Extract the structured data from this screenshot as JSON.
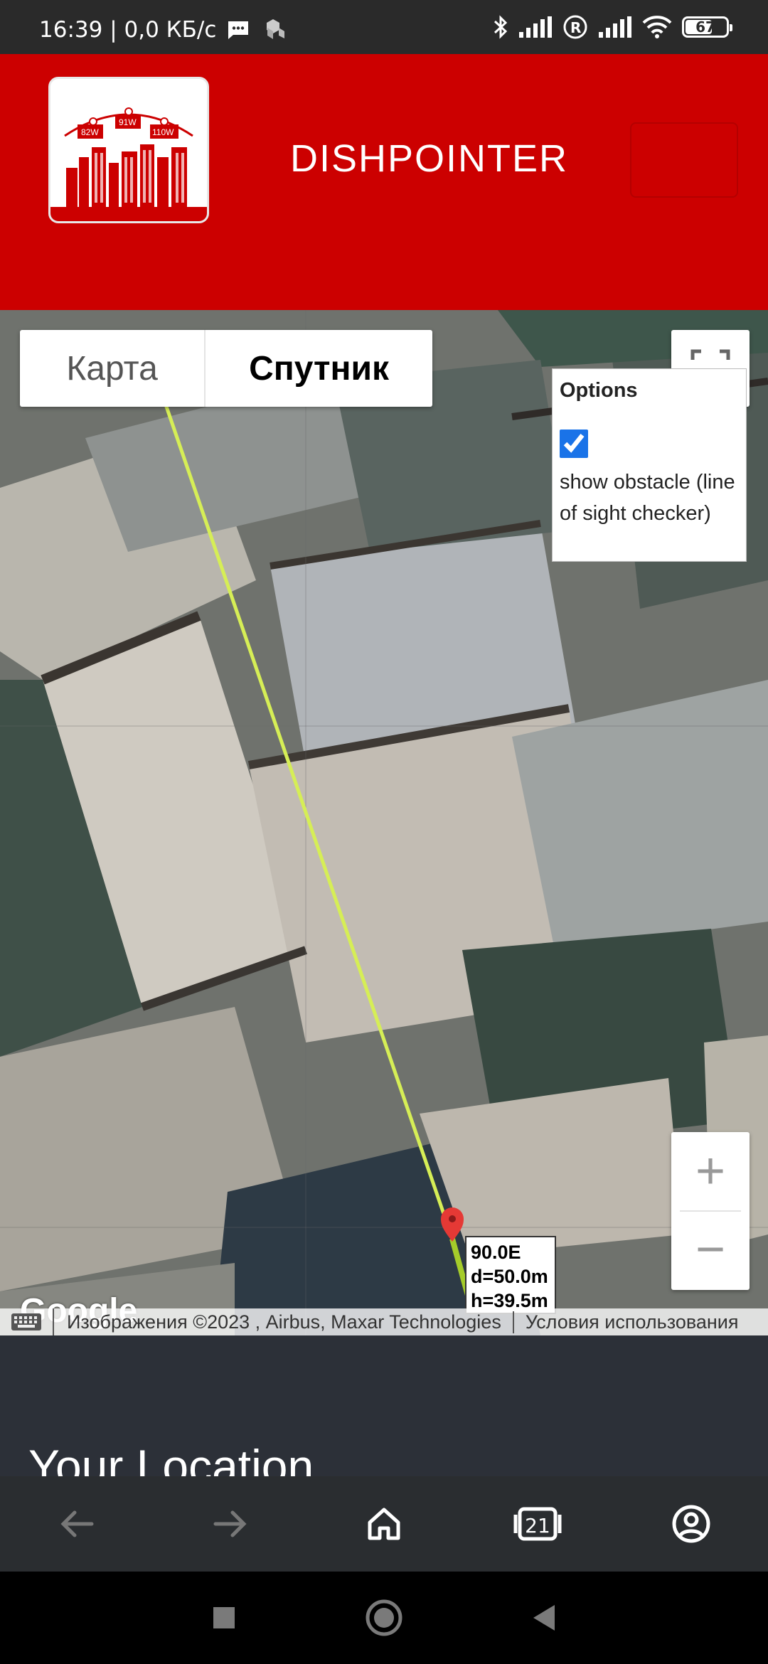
{
  "status_bar": {
    "time_speed": "16:39 | 0,0 КБ/с",
    "battery": "67"
  },
  "header": {
    "title": "DISHPOINTER",
    "logo_labels": [
      "82W",
      "91W",
      "110W"
    ]
  },
  "map": {
    "type_tabs": [
      "Карта",
      "Спутник"
    ],
    "selected_tab": "Спутник",
    "options": {
      "title": "Options",
      "checkbox_label": "show obstacle (line of sight checker)",
      "checked": true
    },
    "zoom": {
      "in": "+",
      "out": "−"
    },
    "marker_info": {
      "line1": "90.0E",
      "line2": "d=50.0m",
      "line3": "h=39.5m"
    },
    "google_logo": "Google",
    "attribution": "Изображения ©2023 , Airbus, Maxar Technologies",
    "terms": "Условия использования",
    "line_color": "#d6ee56",
    "marker_color": "#e53935"
  },
  "page": {
    "location_heading": "Your Location"
  },
  "colors": {
    "brand_red": "#cc0000",
    "page_bg": "#2c3038"
  }
}
